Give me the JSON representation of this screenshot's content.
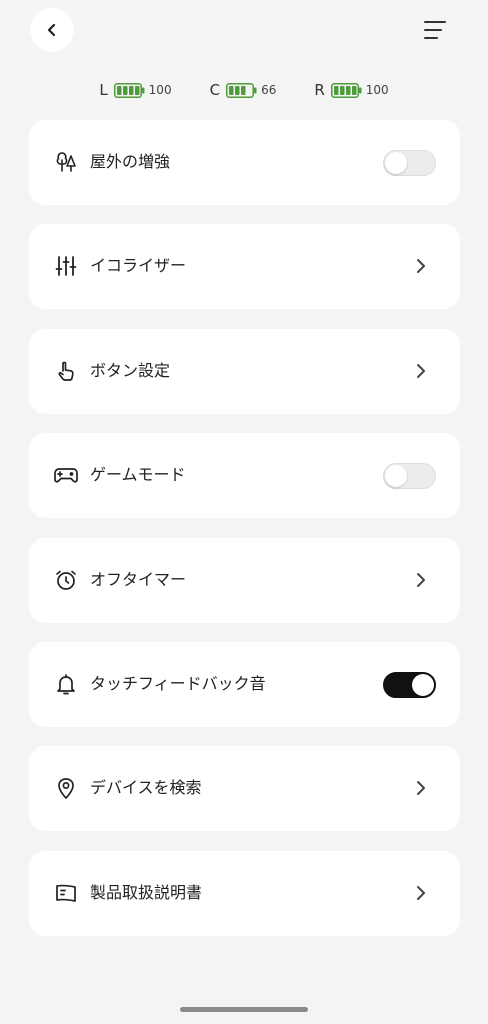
{
  "header": {
    "back_icon": "chevron-left-icon",
    "menu_icon": "hamburger-menu-icon"
  },
  "battery": [
    {
      "side": "L",
      "level": "100",
      "fill": 1.0
    },
    {
      "side": "C",
      "level": "66",
      "fill": 0.66
    },
    {
      "side": "R",
      "level": "100",
      "fill": 1.0
    }
  ],
  "battery_color": "#4d9b3a",
  "settings": [
    {
      "label": "屋外の増強",
      "icon": "trees-icon",
      "control": "toggle",
      "state": "off"
    },
    {
      "label": "イコライザー",
      "icon": "equalizer-sliders-icon",
      "control": "chevron"
    },
    {
      "label": "ボタン設定",
      "icon": "tap-hand-icon",
      "control": "chevron"
    },
    {
      "label": "ゲームモード",
      "icon": "gamepad-icon",
      "control": "toggle",
      "state": "off"
    },
    {
      "label": "オフタイマー",
      "icon": "alarm-clock-icon",
      "control": "chevron"
    },
    {
      "label": "タッチフィードバック音",
      "icon": "bell-icon",
      "control": "toggle",
      "state": "on"
    },
    {
      "label": "デバイスを検索",
      "icon": "location-pin-icon",
      "control": "chevron"
    },
    {
      "label": "製品取扱説明書",
      "icon": "manual-book-icon",
      "control": "chevron"
    }
  ]
}
